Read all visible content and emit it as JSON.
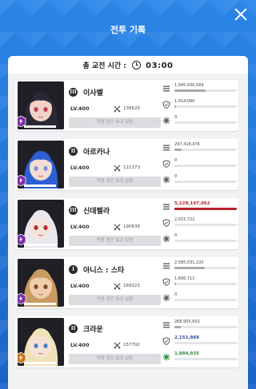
{
  "header": {
    "title": "전투 기록"
  },
  "summary": {
    "label": "총 교전 시간 :",
    "time": "03:00"
  },
  "effect_empty_label": "적용 중인 효과 없음",
  "characters": [
    {
      "name": "이사벨",
      "burst": "III",
      "level": "LV.400",
      "power": "139625",
      "role_color": "#7a2aa8",
      "damage": "1,945,436,569",
      "damage_fill": 0.5,
      "damage_taken": "1,914,060",
      "damage_taken_fill": 0.02,
      "heal": "0",
      "heal_fill": 0,
      "highlight": "none"
    },
    {
      "name": "아르카나",
      "burst": "II",
      "level": "LV.400",
      "power": "121373",
      "role_color": "#7a2aa8",
      "damage": "297,418,476",
      "damage_fill": 0.12,
      "damage_taken": "0",
      "damage_taken_fill": 0,
      "heal": "0",
      "heal_fill": 0,
      "highlight": "none"
    },
    {
      "name": "신데렐라",
      "burst": "III",
      "level": "LV.400",
      "power": "190639",
      "role_color": "#7a2aa8",
      "damage": "5,228,197,062",
      "damage_fill": 1.0,
      "damage_taken": "2,015,722",
      "damage_taken_fill": 0,
      "heal": "0",
      "heal_fill": 0,
      "highlight": "damage"
    },
    {
      "name": "아니스 : 스타",
      "burst": "I",
      "level": "LV.400",
      "power": "169323",
      "role_color": "#7a2aa8",
      "damage": "2,585,031,220",
      "damage_fill": 0.49,
      "damage_taken": "1,606,711",
      "damage_taken_fill": 0.02,
      "heal": "0",
      "heal_fill": 0,
      "highlight": "none"
    },
    {
      "name": "크라운",
      "burst": "II",
      "level": "LV.400",
      "power": "157792",
      "role_color": "#c9741c",
      "damage": "268,955,602",
      "damage_fill": 0.1,
      "damage_taken": "2,151,868",
      "damage_taken_fill": 0,
      "heal": "1,884,935",
      "heal_fill": 0,
      "highlight": "defense"
    }
  ],
  "colors": {
    "accent_blue": "#1e6fd0",
    "damage_red": "#b8222a",
    "damage_gray": "#a9aaae",
    "defense_blue": "#2d4a9a",
    "heal_green": "#2f8a3c"
  }
}
